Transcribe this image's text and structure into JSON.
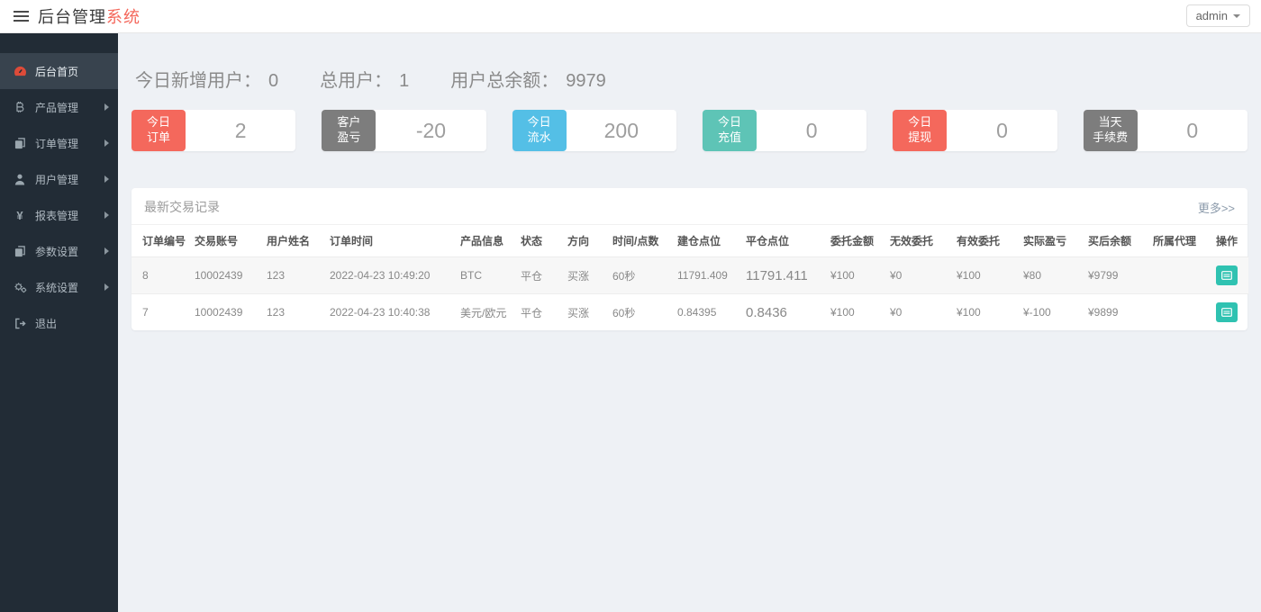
{
  "header": {
    "title_main": "后台管理",
    "title_accent": "系统",
    "user_menu_label": "admin"
  },
  "sidebar": {
    "items": [
      {
        "label": "后台首页",
        "icon": "dashboard-icon",
        "active": true
      },
      {
        "label": "产品管理",
        "icon": "bitcoin-icon"
      },
      {
        "label": "订单管理",
        "icon": "orders-icon"
      },
      {
        "label": "用户管理",
        "icon": "user-icon"
      },
      {
        "label": "报表管理",
        "icon": "yen-icon"
      },
      {
        "label": "参数设置",
        "icon": "params-icon"
      },
      {
        "label": "系统设置",
        "icon": "gears-icon"
      },
      {
        "label": "退出",
        "icon": "logout-icon"
      }
    ]
  },
  "summary": {
    "new_users_label": "今日新增用户：",
    "new_users_value": "0",
    "total_users_label": "总用户：",
    "total_users_value": "1",
    "total_balance_label": "用户总余额：",
    "total_balance_value": "9979"
  },
  "stat_cards": [
    {
      "label": "今日\n订单",
      "value": "2",
      "color": "#f4685c"
    },
    {
      "label": "客户\n盈亏",
      "value": "-20",
      "color": "#7d7d7d"
    },
    {
      "label": "今日\n流水",
      "value": "200",
      "color": "#54bfe6"
    },
    {
      "label": "今日\n充值",
      "value": "0",
      "color": "#5ec4b6"
    },
    {
      "label": "今日\n提现",
      "value": "0",
      "color": "#f4685c"
    },
    {
      "label": "当天\n手续费",
      "value": "0",
      "color": "#7d7d7d"
    }
  ],
  "table": {
    "title": "最新交易记录",
    "more_link": "更多>>",
    "columns": [
      "订单编号",
      "交易账号",
      "用户姓名",
      "订单时间",
      "产品信息",
      "状态",
      "方向",
      "时间/点数",
      "建仓点位",
      "平仓点位",
      "委托金额",
      "无效委托",
      "有效委托",
      "实际盈亏",
      "买后余额",
      "所属代理",
      "操作"
    ],
    "rows": [
      {
        "order_id": "8",
        "account": "10002439",
        "username": "123",
        "order_time": "2022-04-23 10:49:20",
        "product": "BTC",
        "status": "平仓",
        "direction": "买涨",
        "duration": "60秒",
        "open_price": "11791.409",
        "close_price": "11791.411",
        "entrust_amount": "¥100",
        "invalid_entrust": "¥0",
        "valid_entrust": "¥100",
        "actual_pnl": "¥80",
        "balance_after": "¥9799",
        "agent": ""
      },
      {
        "order_id": "7",
        "account": "10002439",
        "username": "123",
        "order_time": "2022-04-23 10:40:38",
        "product": "美元/欧元",
        "status": "平仓",
        "direction": "买涨",
        "duration": "60秒",
        "open_price": "0.84395",
        "close_price": "0.8436",
        "entrust_amount": "¥100",
        "invalid_entrust": "¥0",
        "valid_entrust": "¥100",
        "actual_pnl": "¥-100",
        "balance_after": "¥9899",
        "agent": ""
      }
    ]
  },
  "colors": {
    "accent_red": "#f4685c",
    "card_gray": "#7d7d7d",
    "card_blue": "#54bfe6",
    "card_teal": "#5ec4b6",
    "gain_red_text": "#ed4b3b",
    "loss_green_text": "#21a366",
    "action_button_teal": "#2fc2b1",
    "sidebar_bg": "#222c36"
  }
}
